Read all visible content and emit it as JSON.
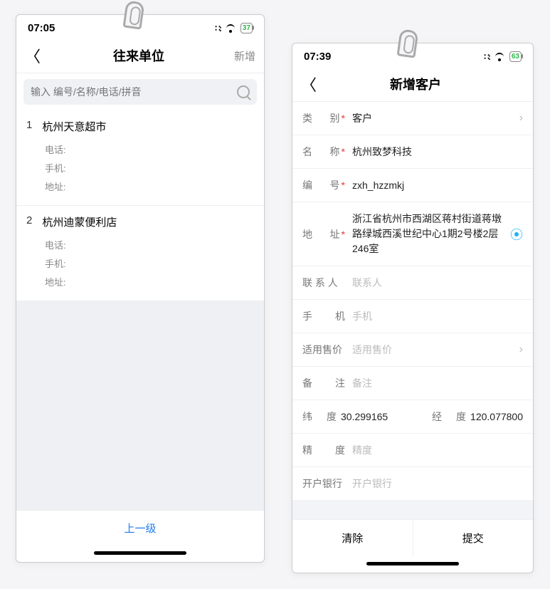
{
  "left": {
    "status": {
      "time": "07:05",
      "battery": "37"
    },
    "title": "往来单位",
    "title_action": "新增",
    "search_placeholder": "输入 编号/名称/电话/拼音",
    "items": [
      {
        "num": "1",
        "name": "杭州天意超市",
        "tel_label": "电话:",
        "mobile_label": "手机:",
        "addr_label": "地址:"
      },
      {
        "num": "2",
        "name": "杭州迪蒙便利店",
        "tel_label": "电话:",
        "mobile_label": "手机:",
        "addr_label": "地址:"
      }
    ],
    "bottom_link": "上一级"
  },
  "right": {
    "status": {
      "time": "07:39",
      "battery": "63"
    },
    "title": "新增客户",
    "rows": {
      "type": {
        "label_a": "类",
        "label_b": "别",
        "value": "客户"
      },
      "name": {
        "label_a": "名",
        "label_b": "称",
        "value": "杭州致梦科技"
      },
      "code": {
        "label_a": "编",
        "label_b": "号",
        "value": "zxh_hzzmkj"
      },
      "address": {
        "label_a": "地",
        "label_b": "址",
        "value": "浙江省杭州市西湖区蒋村街道蒋墩路绿城西溪世纪中心1期2号楼2层246室"
      },
      "contact": {
        "label": "联 系 人",
        "placeholder": "联系人"
      },
      "mobile": {
        "label_a": "手",
        "label_b": "机",
        "placeholder": "手机"
      },
      "price": {
        "label": "适用售价",
        "placeholder": "适用售价"
      },
      "remark": {
        "label_a": "备",
        "label_b": "注",
        "placeholder": "备注"
      },
      "lat": {
        "label_a": "纬",
        "label_b": "度",
        "value": "30.299165"
      },
      "lng": {
        "label_a": "经",
        "label_b": "度",
        "value": "120.077800"
      },
      "accuracy": {
        "label_a": "精",
        "label_b": "度",
        "placeholder": "精度"
      },
      "bank": {
        "label": "开户银行",
        "placeholder": "开户银行"
      }
    },
    "buttons": {
      "clear": "清除",
      "submit": "提交"
    }
  }
}
